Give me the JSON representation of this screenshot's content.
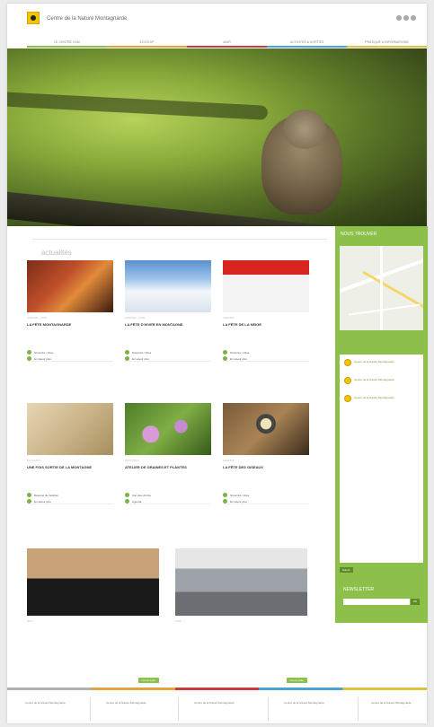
{
  "header": {
    "site_title": "Centre de la Nature Montagnarde",
    "social_icons": [
      "facebook-icon",
      "twitter-icon",
      "rss-icon"
    ]
  },
  "nav": {
    "items": [
      {
        "label": "LE CENTRE CNM",
        "color": "#8bc34a"
      },
      {
        "label": "ECO-EXP",
        "color": "#e5a33c"
      },
      {
        "label": "AGIR",
        "color": "#c53d3d"
      },
      {
        "label": "ACTIVITÉS & SORTIES",
        "color": "#4aa3d6"
      },
      {
        "label": "PRATIQUE & INFORMATIONS",
        "color": "#e0c33a"
      }
    ]
  },
  "main": {
    "section_title": "actualités",
    "cards": [
      {
        "cat": "AGENDA · CNM",
        "title": "LA FÊTE MONTAGNARDE",
        "body": "",
        "links": [
          "S'inscrire / Infos",
          "En savoir plus"
        ]
      },
      {
        "cat": "AGENDA · CNM",
        "title": "LA FÊTE D'HIVER EN MONTAGNE",
        "body": "",
        "links": [
          "S'inscrire / Infos",
          "En savoir plus"
        ]
      },
      {
        "cat": "AGENDA",
        "title": "LA FÊTE DE LA NEIGE",
        "body": "",
        "links": [
          "S'inscrire / Infos",
          "En savoir plus"
        ]
      },
      {
        "cat": "ECO-EXPO",
        "title": "UNE FOIS SORTIE DE LA MONTAGNE",
        "body": "",
        "links": [
          "Résumé de l'activité",
          "En savoir plus"
        ]
      },
      {
        "cat": "ACTIVITÉS",
        "title": "ATELIER DE GRAINES ET PLANTES",
        "body": "",
        "links": [
          "Voir plus d'infos",
          "Agenda"
        ]
      },
      {
        "cat": "AGENDA",
        "title": "LA FÊTE DES OISEAUX",
        "body": "",
        "links": [
          "S'inscrire / Infos",
          "En savoir plus"
        ]
      }
    ],
    "wide_cards": [
      {
        "cat": "ECO",
        "title": "",
        "body": "",
        "more": "Lire la suite"
      },
      {
        "cat": "CNM",
        "title": "",
        "body": "",
        "more": "Lire la suite"
      }
    ]
  },
  "sidebar": {
    "map_title": "NOUS TROUVER",
    "map_caption": "",
    "tweets": [
      {
        "name": "Centre de la Nature Montagnarde",
        "text": "",
        "meta": ""
      },
      {
        "name": "Centre de la Nature Montagnarde",
        "text": "",
        "meta": ""
      },
      {
        "name": "Centre de la Nature Montagnarde",
        "text": "",
        "meta": ""
      }
    ],
    "feed_button": "Suivre",
    "newsletter_title": "NEWSLETTER",
    "newsletter_placeholder": "",
    "newsletter_ok": "OK"
  },
  "footer": {
    "cols": [
      "Centre de la Nature Montagnarde",
      "Centre de la Nature Montagnarde",
      "Centre de la Nature Montagnarde",
      "Centre de la Nature Montagnarde",
      "Centre de la Nature Montagnarde"
    ]
  },
  "colors": {
    "accent_green": "#8cc04a",
    "dark_green": "#5f8a2a",
    "logo_yellow": "#f2c500"
  }
}
